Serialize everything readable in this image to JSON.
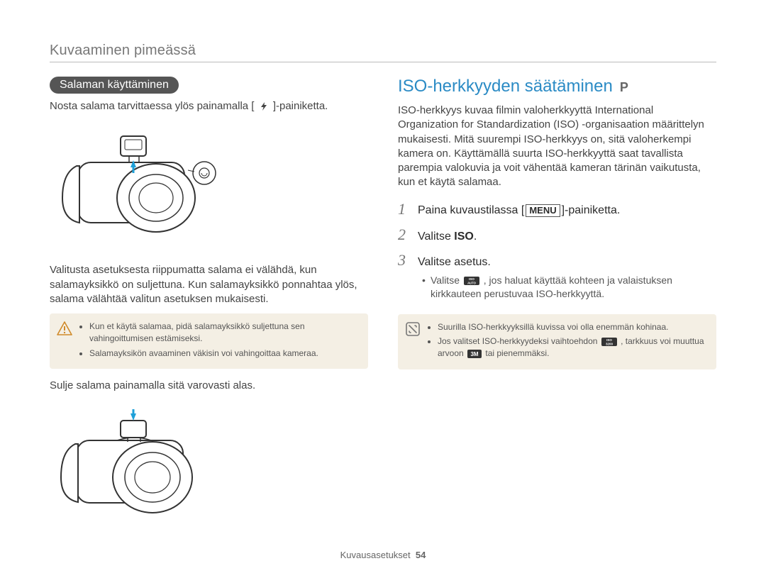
{
  "header": {
    "title": "Kuvaaminen pimeässä"
  },
  "left": {
    "pill": "Salaman käyttäminen",
    "line1_a": "Nosta salama tarvittaessa ylös painamalla [",
    "line1_b": "]-painiketta.",
    "para2": "Valitusta asetuksesta riippumatta salama ei välähdä, kun salamayksikkö on suljettuna. Kun salamayksikkö ponnahtaa ylös, salama välähtää valitun asetuksen mukaisesti.",
    "note": {
      "items": [
        "Kun et käytä salamaa, pidä salamayksikkö suljettuna sen vahingoittumisen estämiseksi.",
        "Salamayksikön avaaminen väkisin voi vahingoittaa kameraa."
      ]
    },
    "para3": "Sulje salama painamalla sitä varovasti alas."
  },
  "right": {
    "h2": "ISO-herkkyyden säätäminen",
    "mode": "P",
    "intro": "ISO-herkkyys kuvaa filmin valoherkkyyttä International Organization for Standardization (ISO) -organisaation määrittelyn mukaisesti. Mitä suurempi ISO-herkkyys on, sitä valoherkempi kamera on. Käyttämällä suurta ISO-herkkyyttä saat tavallista parempia valokuvia ja voit vähentää kameran tärinän vaikutusta, kun et käytä salamaa.",
    "steps": {
      "s1_a": "Paina kuvaustilassa [",
      "s1_menu": "MENU",
      "s1_b": "]-painiketta.",
      "s2_a": "Valitse ",
      "s2_b": "ISO",
      "s2_c": ".",
      "s3": "Valitse asetus.",
      "s3_sub_a": "Valitse ",
      "s3_sub_b": ", jos haluat käyttää kohteen ja valaistuksen kirkkauteen perustuvaa ISO-herkkyyttä."
    },
    "note": {
      "items_a": "Suurilla ISO-herkkyyksillä kuvissa voi olla enemmän kohinaa.",
      "items_b_1": "Jos valitset ISO-herkkyydeksi vaihtoehdon ",
      "items_b_2": ", tarkkuus voi muuttua arvoon ",
      "items_b_3": " tai pienemmäksi."
    }
  },
  "footer": {
    "section": "Kuvausasetukset",
    "page": "54"
  }
}
